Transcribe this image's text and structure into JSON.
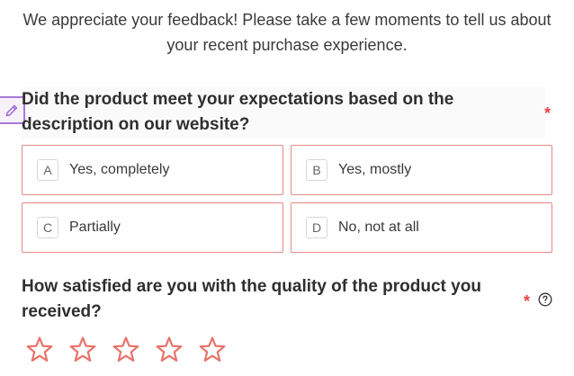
{
  "intro": {
    "text": "We appreciate your feedback! Please take a few moments to tell us about your recent purchase experience."
  },
  "question1": {
    "title": "Did the product meet your expectations based on the description on our website?",
    "required_marker": "*",
    "options": [
      {
        "key": "A",
        "label": "Yes, completely"
      },
      {
        "key": "B",
        "label": "Yes, mostly"
      },
      {
        "key": "C",
        "label": "Partially"
      },
      {
        "key": "D",
        "label": "No, not at all"
      }
    ]
  },
  "question2": {
    "title": "How satisfied are you with the quality of the product you received?",
    "required_marker": "*",
    "rating": {
      "max": 5,
      "value": 0
    }
  },
  "colors": {
    "accent": "#e4463f",
    "option_border": "#e58a85",
    "star_outline": "#e8736b",
    "edit_handle": "#a878d6"
  },
  "icons": {
    "edit": "pencil-icon",
    "help": "help-circle-icon",
    "rating": "star-outline-icon"
  }
}
